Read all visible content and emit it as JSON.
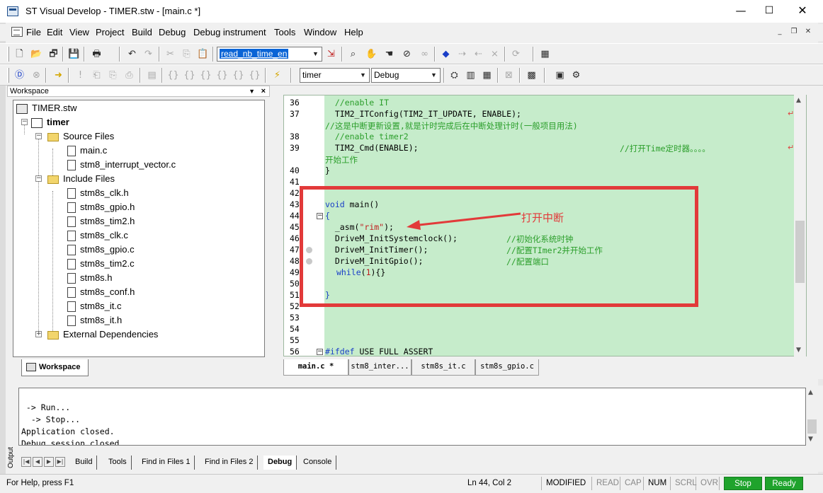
{
  "window": {
    "title": "ST Visual Develop - TIMER.stw - [main.c *]",
    "minimize": "—",
    "maximize": "☐",
    "close": "✕"
  },
  "menu": {
    "items": [
      "File",
      "Edit",
      "View",
      "Project",
      "Build",
      "Debug",
      "Debug instrument",
      "Tools",
      "Window",
      "Help"
    ],
    "mdi_min": "_",
    "mdi_restore": "❐",
    "mdi_close": "✕"
  },
  "toolbar": {
    "find_value": "read_nb_time_en",
    "project_value": "timer",
    "config_value": "Debug"
  },
  "workspace": {
    "title": "Workspace",
    "tab_label": "Workspace",
    "tree": {
      "root": "TIMER.stw",
      "project": "timer",
      "source_folder": "Source Files",
      "source_files": [
        "main.c",
        "stm8_interrupt_vector.c"
      ],
      "include_folder": "Include Files",
      "include_files": [
        "stm8s_clk.h",
        "stm8s_gpio.h",
        "stm8s_tim2.h",
        "stm8s_clk.c",
        "stm8s_gpio.c",
        "stm8s_tim2.c",
        "stm8s.h",
        "stm8s_conf.h",
        "stm8s_it.c",
        "stm8s_it.h"
      ],
      "external_folder": "External Dependencies"
    }
  },
  "editor": {
    "line_numbers": [
      "36",
      "37",
      "38",
      "39",
      "40",
      "41",
      "42",
      "43",
      "44",
      "45",
      "46",
      "47",
      "48",
      "49",
      "50",
      "51",
      "52",
      "53",
      "54",
      "55",
      "56"
    ],
    "lines": {
      "l36": "  //enable IT",
      "l37": "  TIM2_ITConfig(TIM2_IT_UPDATE, ENABLE);",
      "l37b": "//这是中断更新设置,就是计时完成后在中断处理计时(一般项目用法)",
      "l38": "  //enable timer2",
      "l39a": "  TIM2_Cmd(ENABLE);",
      "l39c": "//打开Time定时器。。。。",
      "l39b": "开始工作",
      "l40": "}",
      "l43a": "void",
      "l43b": " main()",
      "l44": "{",
      "l45a": "  _asm(",
      "l45b": "\"rim\"",
      "l45c": ");",
      "l46a": "  DriveM_InitSystemclock();",
      "l46c": "//初始化系统时钟",
      "l47a": "  DriveM_InitTimer();",
      "l47c": "//配置TImer2并开始工作",
      "l48a": "  DriveM_InitGpio();",
      "l48c": "//配置端口",
      "l49a": "while",
      "l49b": "(",
      "l49n": "1",
      "l49c": "){}",
      "l51": "}",
      "l56a": "#ifdef",
      "l56b": " USE_FULL_ASSERT"
    },
    "annotation": "打开中断",
    "tabs": [
      "main.c *",
      "stm8_inter...",
      "stm8s_it.c",
      "stm8s_gpio.c"
    ]
  },
  "output": {
    "label": "Output",
    "lines": [
      " -> Run...",
      "  -> Stop...",
      "Application closed.",
      "Debug session closed."
    ],
    "tabs": [
      "Build",
      "Tools",
      "Find in Files 1",
      "Find in Files 2",
      "Debug",
      "Console"
    ]
  },
  "status": {
    "help": "For Help, press F1",
    "position": "Ln 44, Col 2",
    "modified": "MODIFIED",
    "read": "READ",
    "cap": "CAP",
    "num": "NUM",
    "scrl": "SCRL",
    "ovr": "OVR",
    "stop": "Stop",
    "ready": "Ready"
  },
  "colors": {
    "editor_bg": "#c6eccb",
    "comment": "#2a9e2a",
    "keyword": "#1a3fc8",
    "annotation": "#e23a3a",
    "status_green": "#1fa32c"
  }
}
